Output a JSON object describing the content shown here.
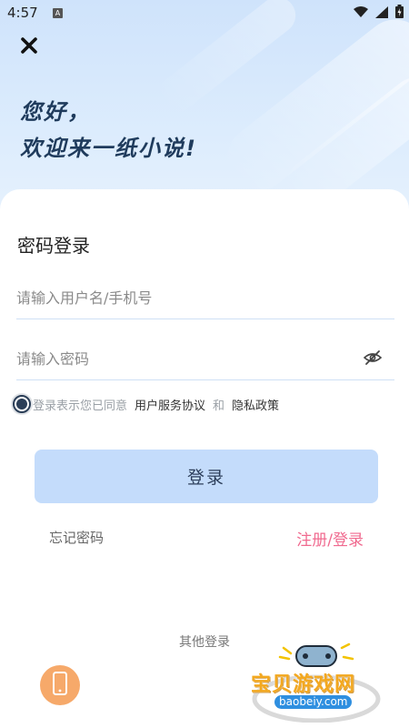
{
  "status_bar": {
    "time": "4:57",
    "notification_letter": "A"
  },
  "header": {
    "greeting_line1": "您好，",
    "greeting_line2": "欢迎来一纸小说!"
  },
  "login": {
    "title": "密码登录",
    "username_placeholder": "请输入用户名/手机号",
    "username_value": "",
    "password_placeholder": "请输入密码",
    "password_value": "",
    "agree_prefix": "登录表示您已同意",
    "terms_link": "用户服务协议",
    "agree_and": "和",
    "privacy_link": "隐私政策",
    "submit_label": "登录",
    "forgot_label": "忘记密码",
    "register_label": "注册/登录",
    "other_login_label": "其他登录"
  },
  "watermark": {
    "title": "宝贝游戏网",
    "url": "baobeiy.com"
  },
  "icons": {
    "close": "close-icon",
    "eye_off": "eye-off-icon",
    "phone": "phone-icon",
    "wifi": "wifi-icon",
    "signal": "signal-icon",
    "battery": "battery-icon"
  },
  "colors": {
    "accent_button": "#c4dcfb",
    "register_link": "#f06a8f",
    "phone_button": "#f6a96a",
    "title_text": "#1f3b5c"
  }
}
